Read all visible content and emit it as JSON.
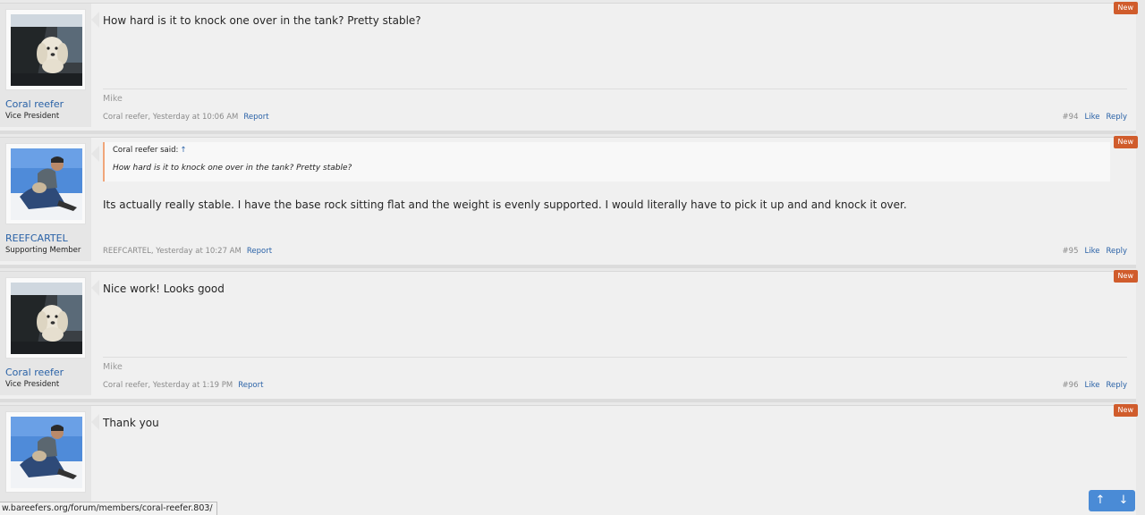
{
  "posts": [
    {
      "user": {
        "name": "Coral reefer",
        "title": "Vice President",
        "avatar": "dog-in-car-avatar"
      },
      "message": "How hard is it to knock one over in the tank? Pretty stable?",
      "signature": "Mike",
      "author": "Coral reefer",
      "date": "Yesterday at 10:06 AM",
      "report": "Report",
      "num": "#94",
      "like": "Like",
      "reply": "Reply",
      "badge": "New"
    },
    {
      "user": {
        "name": "REEFCARTEL",
        "title": "Supporting Member",
        "avatar": "man-with-dog-avatar"
      },
      "quote": {
        "cite": "Coral reefer said:",
        "arrow": "↑",
        "text": "How hard is it to knock one over in the tank? Pretty stable?"
      },
      "message": "Its actually really stable. I have the base rock sitting flat and the weight is evenly supported. I would literally have to pick it up and and knock it over.",
      "author": "REEFCARTEL",
      "date": "Yesterday at 10:27 AM",
      "report": "Report",
      "num": "#95",
      "like": "Like",
      "reply": "Reply",
      "badge": "New"
    },
    {
      "user": {
        "name": "Coral reefer",
        "title": "Vice President",
        "avatar": "dog-in-car-avatar"
      },
      "message": "Nice work! Looks good",
      "signature": "Mike",
      "author": "Coral reefer",
      "date": "Yesterday at 1:19 PM",
      "report": "Report",
      "num": "#96",
      "like": "Like",
      "reply": "Reply",
      "badge": "New"
    },
    {
      "user": {
        "avatar": "man-with-dog-avatar"
      },
      "message": "Thank you",
      "badge": "New"
    }
  ],
  "separator": ", ",
  "status_url": "w.bareefers.org/forum/members/coral-reefer.803/",
  "scroll": {
    "up": "↑",
    "down": "↓"
  },
  "colors": {
    "link": "#2a62a7",
    "badge": "#d05c2c",
    "quote_border": "#f0a67a",
    "scroll_button": "#4a8bd6"
  }
}
